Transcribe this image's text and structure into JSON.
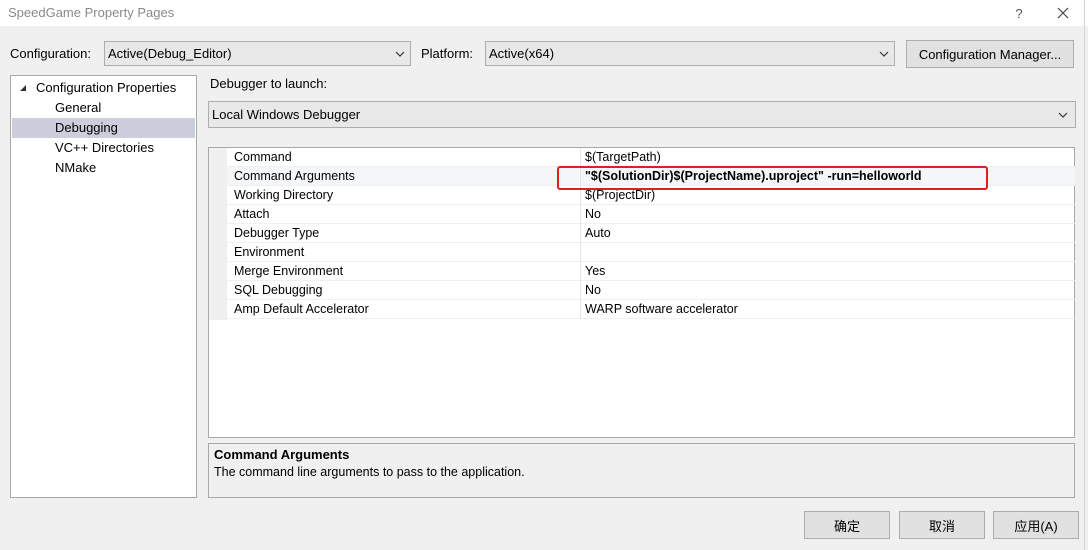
{
  "window": {
    "title": "SpeedGame Property Pages",
    "help": "?"
  },
  "top": {
    "configuration_label": "Configuration:",
    "configuration_value": "Active(Debug_Editor)",
    "platform_label": "Platform:",
    "platform_value": "Active(x64)",
    "config_manager_button": "Configuration Manager..."
  },
  "tree": {
    "root": "Configuration Properties",
    "items": [
      "General",
      "Debugging",
      "VC++ Directories",
      "NMake"
    ],
    "selected": "Debugging"
  },
  "debugger": {
    "label": "Debugger to launch:",
    "value": "Local Windows Debugger"
  },
  "properties": [
    {
      "name": "Command",
      "value": "$(TargetPath)"
    },
    {
      "name": "Command Arguments",
      "value": "\"$(SolutionDir)$(ProjectName).uproject\" -run=helloworld"
    },
    {
      "name": "Working Directory",
      "value": "$(ProjectDir)"
    },
    {
      "name": "Attach",
      "value": "No"
    },
    {
      "name": "Debugger Type",
      "value": "Auto"
    },
    {
      "name": "Environment",
      "value": ""
    },
    {
      "name": "Merge Environment",
      "value": "Yes"
    },
    {
      "name": "SQL Debugging",
      "value": "No"
    },
    {
      "name": "Amp Default Accelerator",
      "value": "WARP software accelerator"
    }
  ],
  "description": {
    "title": "Command Arguments",
    "text": "The command line arguments to pass to the application."
  },
  "buttons": {
    "ok": "确定",
    "cancel": "取消",
    "apply": "应用(A)"
  },
  "colors": {
    "highlight_box": "#e02020",
    "selected_tree": "#cccedb"
  }
}
